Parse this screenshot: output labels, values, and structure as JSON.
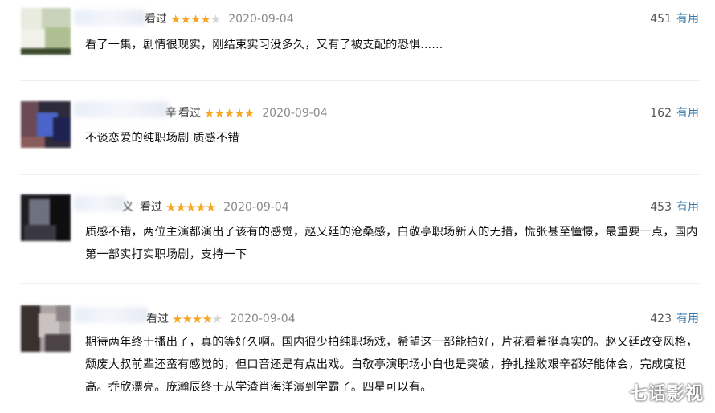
{
  "reviews": [
    {
      "name_tail": "",
      "watched": "看过",
      "stars_on": "★★★★",
      "stars_off": "★",
      "rating": 4,
      "date": "2020-09-04",
      "votes": "451",
      "useful": "有用",
      "text": "看了一集，剧情很现实，刚结束实习没多久，又有了被支配的恐惧......"
    },
    {
      "name_tail": "辛",
      "watched": "看过",
      "stars_on": "★★★★★",
      "stars_off": "",
      "rating": 5,
      "date": "2020-09-04",
      "votes": "162",
      "useful": "有用",
      "text": "不谈恋爱的纯职场剧 质感不错"
    },
    {
      "name_tail": "义",
      "watched": "看过",
      "stars_on": "★★★★★",
      "stars_off": "",
      "rating": 5,
      "date": "2020-09-04",
      "votes": "453",
      "useful": "有用",
      "text": "质感不错，两位主演都演出了该有的感觉，赵又廷的沧桑感，白敬亭职场新人的无措，慌张甚至憧憬，最重要一点，国内第一部实打实职场剧，支持一下"
    },
    {
      "name_tail": "",
      "watched": "看过",
      "stars_on": "★★★★",
      "stars_off": "★",
      "rating": 4,
      "date": "2020-09-04",
      "votes": "423",
      "useful": "有用",
      "text": "期待两年终于播出了，真的等好久啊。国内很少拍纯职场戏，希望这一部能拍好，片花看着挺真实的。赵又廷改变风格，颓废大叔前辈还蛮有感觉的，但口音还是有点出戏。白敬亭演职场小白也是突破，挣扎挫败艰辛都好能体会，完成度挺高。乔欣漂亮。庞瀚辰终于从学渣肖海洋演到学霸了。四星可以有。"
    }
  ],
  "watermark": "七话影视"
}
